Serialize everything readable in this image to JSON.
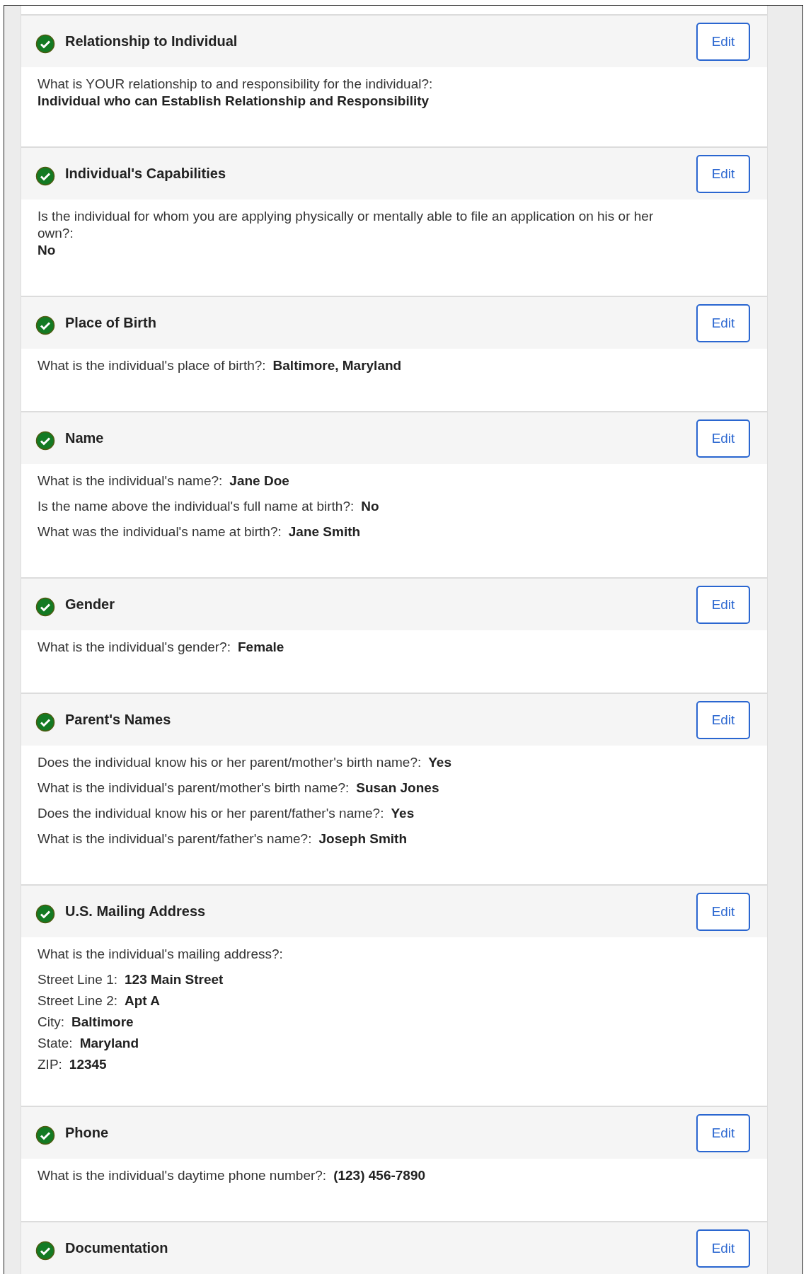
{
  "sections": [
    {
      "title": "Relationship to Individual",
      "complete": true,
      "edit": "Edit",
      "rows": [
        {
          "label": "What is YOUR relationship to and responsibility for the individual?:",
          "value": "Individual who can Establish Relationship and Responsibility"
        }
      ]
    },
    {
      "title": "Individual's Capabilities",
      "complete": true,
      "edit": "Edit",
      "rows": [
        {
          "label": "Is the individual for whom you are applying physically or mentally able to file an application on his or her own?:",
          "value": "No"
        }
      ]
    },
    {
      "title": "Place of Birth",
      "complete": true,
      "edit": "Edit",
      "rows": [
        {
          "label": "What is the individual's place of birth?:",
          "value": "Baltimore, Maryland"
        }
      ]
    },
    {
      "title": "Name",
      "complete": true,
      "edit": "Edit",
      "rows": [
        {
          "label": "What is the individual's name?:",
          "value": "Jane Doe"
        },
        {
          "label": "Is the name above the individual's full name at birth?:",
          "value": "No"
        },
        {
          "label": "What was the individual's name at birth?:",
          "value": "Jane Smith"
        }
      ]
    },
    {
      "title": "Gender",
      "complete": true,
      "edit": "Edit",
      "rows": [
        {
          "label": "What is the individual's gender?:",
          "value": "Female"
        }
      ]
    },
    {
      "title": "Parent's Names",
      "complete": true,
      "edit": "Edit",
      "rows": [
        {
          "label": "Does the individual know his or her parent/mother's birth name?:",
          "value": "Yes"
        },
        {
          "label": "What is the individual's parent/mother's birth name?:",
          "value": "Susan Jones"
        },
        {
          "label": "Does the individual know his or her parent/father's name?:",
          "value": "Yes"
        },
        {
          "label": "What is the individual's parent/father's name?:",
          "value": "Joseph Smith"
        }
      ]
    },
    {
      "title": "U.S. Mailing Address",
      "complete": true,
      "edit": "Edit",
      "rows": [
        {
          "label": "What is the individual's mailing address?:"
        },
        {
          "kind": "compact",
          "label": "Street Line 1:",
          "value": "123 Main Street"
        },
        {
          "kind": "compact",
          "label": "Street Line 2:",
          "value": "Apt A"
        },
        {
          "kind": "compact",
          "label": "City:",
          "value": "Baltimore"
        },
        {
          "kind": "compact",
          "label": "State:",
          "value": "Maryland"
        },
        {
          "kind": "compact",
          "label": "ZIP:",
          "value": "12345"
        }
      ]
    },
    {
      "title": "Phone",
      "complete": true,
      "edit": "Edit",
      "rows": [
        {
          "label": "What is the individual's daytime phone number?:",
          "value": "(123) 456-7890"
        }
      ]
    },
    {
      "title": "Documentation",
      "complete": true,
      "edit": "Edit"
    }
  ]
}
